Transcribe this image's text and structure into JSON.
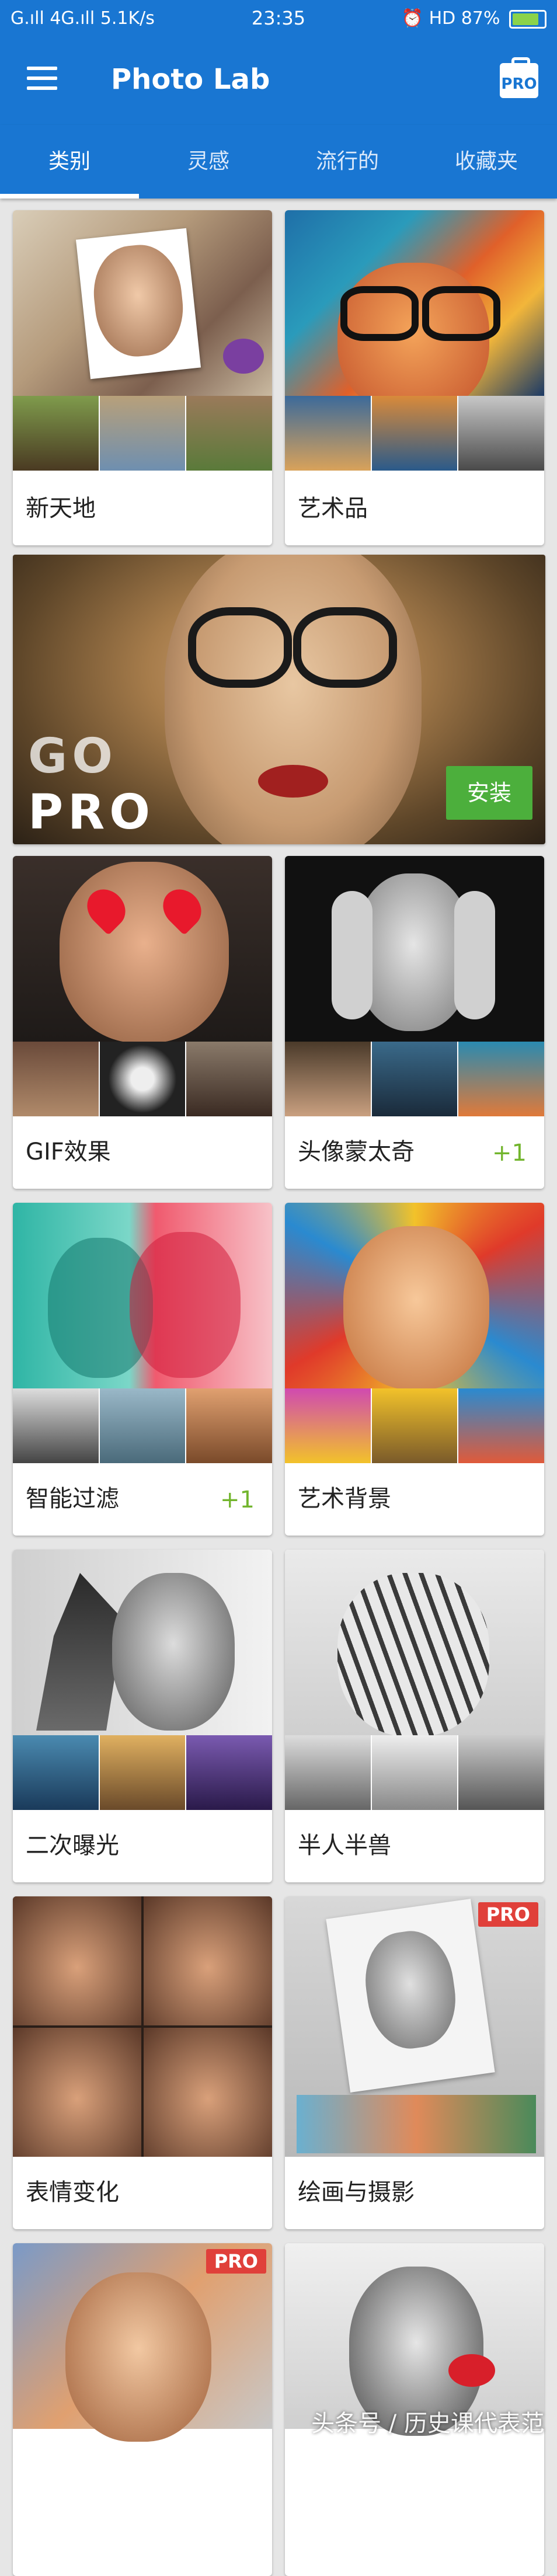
{
  "status_bar": {
    "left": "G.ıll 4G.ıll 5.1K/s",
    "time": "23:35",
    "right": "⏰ HD 87%"
  },
  "app_bar": {
    "title": "Photo Lab",
    "menu_icon": "hamburger-menu-icon",
    "pro_icon": "pro-bag-icon",
    "pro_label": "PRO"
  },
  "tabs": [
    {
      "label": "类别",
      "active": true
    },
    {
      "label": "灵感",
      "active": false
    },
    {
      "label": "流行的",
      "active": false
    },
    {
      "label": "收藏夹",
      "active": false
    }
  ],
  "ad": {
    "line1": "GO",
    "line2": "PRO",
    "install_label": "安装"
  },
  "categories": [
    {
      "label": "新天地",
      "badge": ""
    },
    {
      "label": "艺术品",
      "badge": ""
    },
    {
      "label": "GIF效果",
      "badge": ""
    },
    {
      "label": "头像蒙太奇",
      "badge": "+1"
    },
    {
      "label": "智能过滤",
      "badge": "+1"
    },
    {
      "label": "艺术背景",
      "badge": ""
    },
    {
      "label": "二次曝光",
      "badge": ""
    },
    {
      "label": "半人半兽",
      "badge": ""
    },
    {
      "label": "表情变化",
      "badge": ""
    },
    {
      "label": "绘画与摄影",
      "badge": "",
      "pro": "PRO"
    },
    {
      "label": "",
      "badge": "",
      "pro": "PRO"
    },
    {
      "label": "",
      "badge": ""
    }
  ],
  "watermark": "头条号 / 历史课代表范"
}
